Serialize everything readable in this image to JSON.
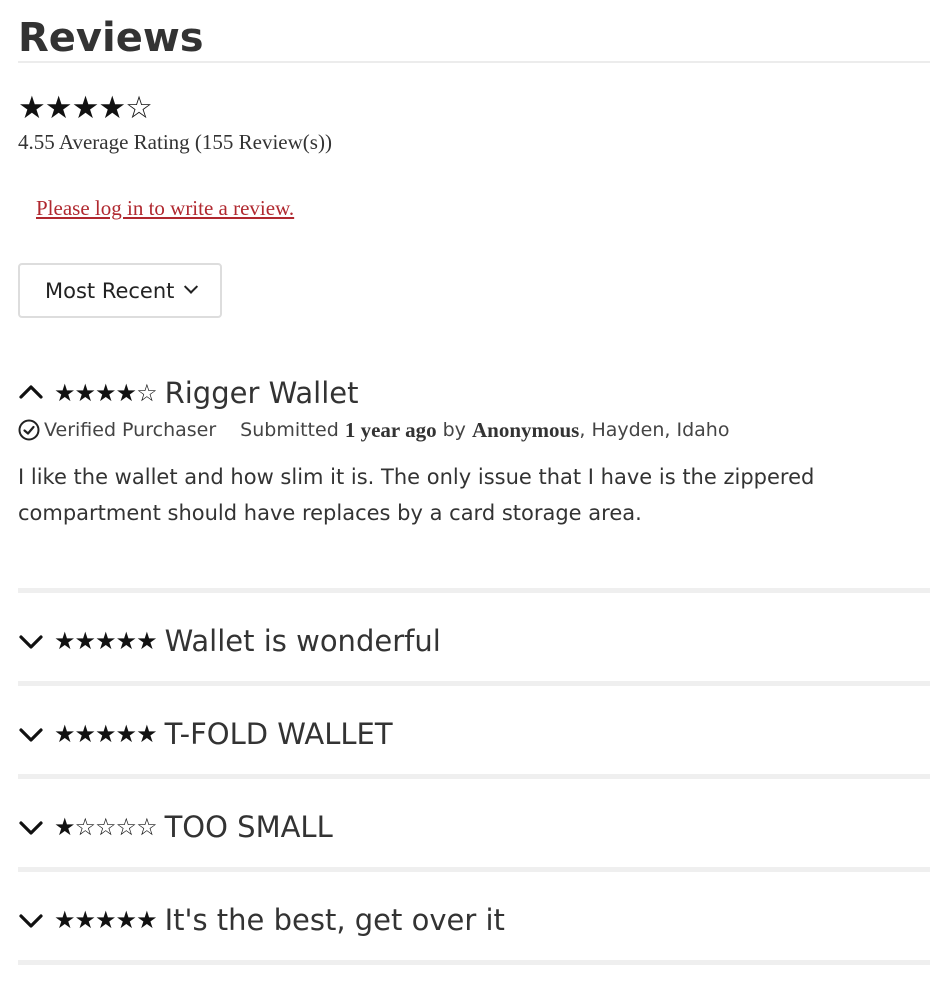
{
  "reviews_section": {
    "title": "Reviews",
    "average_stars_display": "★★★★☆",
    "average_text": "4.55 Average Rating (155 Review(s))",
    "login_prompt": "Please log in to write a review.",
    "sort": {
      "selected": "Most Recent"
    }
  },
  "reviews": [
    {
      "stars_display": "★★★★☆",
      "rating": 4,
      "title": "Rigger Wallet",
      "expanded": true,
      "verified_label": "Verified Purchaser",
      "submitted_label": "Submitted",
      "submitted_when": "1 year ago",
      "by_label": "by",
      "author": "Anonymous",
      "location": ", Hayden, Idaho",
      "body": "I like the wallet and how slim it is. The only issue that I have is the zippered compartment should have replaces by a card storage area."
    },
    {
      "stars_display": "★★★★★",
      "rating": 5,
      "title": "Wallet is wonderful",
      "expanded": false
    },
    {
      "stars_display": "★★★★★",
      "rating": 5,
      "title": "T-FOLD WALLET",
      "expanded": false
    },
    {
      "stars_display": "★☆☆☆☆",
      "rating": 1,
      "title": "TOO SMALL",
      "expanded": false
    },
    {
      "stars_display": "★★★★★",
      "rating": 5,
      "title": "It's the best, get over it",
      "expanded": false
    }
  ],
  "icons": {
    "collapse": "chevron-up-icon",
    "expand": "chevron-down-icon",
    "verified": "check-circle-icon",
    "sort": "chevron-down-icon"
  },
  "colors": {
    "login_link": "#b0282f",
    "divider": "#efefef",
    "text": "#333333"
  }
}
